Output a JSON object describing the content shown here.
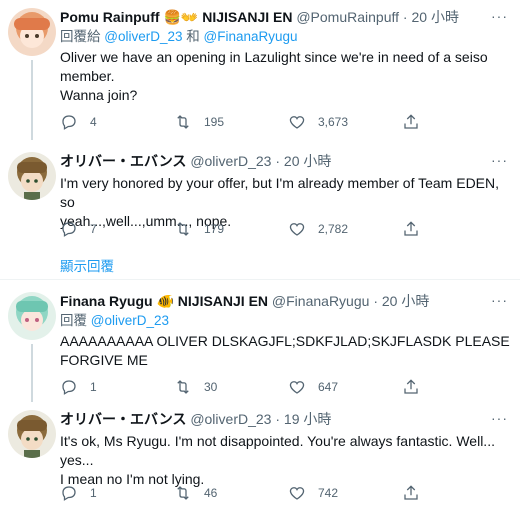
{
  "tweets": [
    {
      "name": "Pomu Rainpuff",
      "name_suffix": "NIJISANJI EN",
      "handle": "@PomuRainpuff",
      "time": "20 小時",
      "reply_prefix": "回覆給",
      "reply_mention1": "@oliverD_23",
      "reply_and": "和",
      "reply_mention2": "@FinanaRyugu",
      "text_line1": "Oliver we have an opening in Lazulight since we're in need of a seiso",
      "text_line2": "member.",
      "text_line3": "Wanna join?",
      "replies": "4",
      "retweets": "195",
      "likes": "3,673"
    },
    {
      "name": "オリバー・エバンス",
      "handle": "@oliverD_23",
      "time": "20 小時",
      "text_line1": "I'm very honored by your offer, but I'm already member of Team EDEN, so",
      "text_line2": "yeah...,well...,umm...,  nope.",
      "replies": "7",
      "retweets": "179",
      "likes": "2,782"
    },
    {
      "name": "Finana Ryugu",
      "name_suffix": "NIJISANJI EN",
      "handle": "@FinanaRyugu",
      "time": "20 小時",
      "reply_prefix": "回覆",
      "reply_mention1": "@oliverD_23",
      "text_line1": "AAAAAAAAAA OLIVER DLSKAGJFL;SDKFJLAD;SKJFLASDK PLEASE",
      "text_line2": "FORGIVE ME",
      "replies": "1",
      "retweets": "30",
      "likes": "647"
    },
    {
      "name": "オリバー・エバンス",
      "handle": "@oliverD_23",
      "time": "19 小時",
      "text_line1": "It's ok, Ms Ryugu. I'm not disappointed. You're always fantastic. Well... yes...",
      "text_line2": "I mean no I'm not lying.",
      "replies": "1",
      "retweets": "46",
      "likes": "742"
    }
  ],
  "show_replies": "顯示回覆",
  "more_label": "···",
  "colors": {
    "accent": "#1d9bf0",
    "muted": "#536471",
    "text": "#0f1419"
  }
}
